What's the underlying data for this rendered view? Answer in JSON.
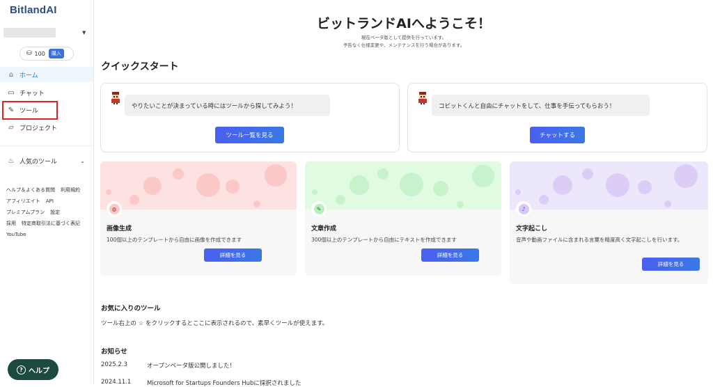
{
  "sidebar": {
    "logo": "BitlandAI",
    "credits": "100",
    "buy_label": "購入",
    "nav": [
      {
        "label": "ホーム",
        "icon": "home-icon"
      },
      {
        "label": "チャット",
        "icon": "chat-icon"
      },
      {
        "label": "ツール",
        "icon": "wrench-icon"
      },
      {
        "label": "プロジェクト",
        "icon": "folder-icon"
      }
    ],
    "popular_tools": "人気のツール",
    "links": [
      "ヘルプ＆よくある質問",
      "利用規約",
      "アフィリエイト",
      "API",
      "プレミアムプラン",
      "設定",
      "採用",
      "特定商取引法に基づく表記",
      "YouTube"
    ],
    "help_label": "ヘルプ"
  },
  "main": {
    "welcome": "ビットランドAIへようこそ！",
    "sub1": "現在ベータ版として提供を行っています。",
    "sub2": "予告なく仕様変更や、メンテナンスを行う場合があります。",
    "quickstart_title": "クイックスタート",
    "quickstart": [
      {
        "message": "やりたいことが決まっている時にはツールから探してみよう！",
        "button": "ツール一覧を見る"
      },
      {
        "message": "コビットくんと自由にチャットをして、仕事を手伝ってもらおう！",
        "button": "チャットする"
      }
    ],
    "features": [
      {
        "title": "画像生成",
        "desc": "100個以上のテンプレートから自由に画像を作成できます",
        "button": "詳細を見る",
        "icon": "palette-icon"
      },
      {
        "title": "文章作成",
        "desc": "300個以上のテンプレートから自由にテキストを作成できます",
        "button": "詳細を見る",
        "icon": "pen-icon"
      },
      {
        "title": "文字起こし",
        "desc": "音声や動画ファイルに含まれる言葉を精度高く文字起こしを行います。",
        "button": "詳細を見る",
        "icon": "microphone-icon"
      }
    ],
    "favorites_title": "お気に入りのツール",
    "favorites_text": "ツール右上の ☆ をクリックするとここに表示されるので、素早くツールが使えます。",
    "news_title": "お知らせ",
    "news": [
      {
        "date": "2025.2.3",
        "text": "オープンベータ版公開しました！"
      },
      {
        "date": "2024.11.1",
        "text": "Microsoft for Startups Founders Hubに採択されました"
      }
    ]
  },
  "colors": {
    "accent": "#3f6be8",
    "home_active": "#2a7fb8",
    "highlight": "#e0211d",
    "help_button": "#1c4a40"
  }
}
